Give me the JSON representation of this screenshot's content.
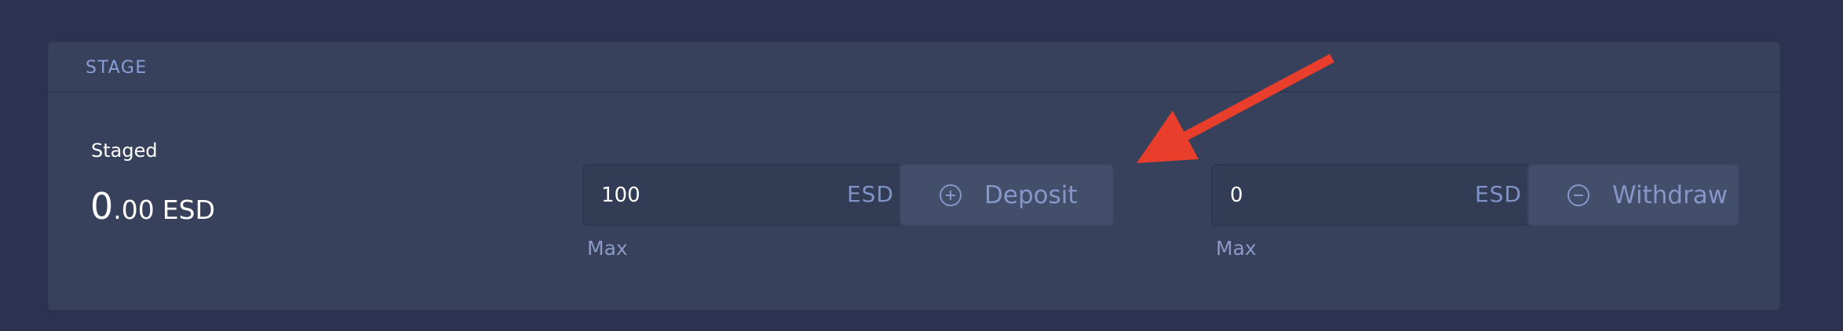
{
  "stage_panel": {
    "title": "STAGE",
    "staged_label": "Staged",
    "staged_value_int": "0",
    "staged_value_dec": ".00",
    "staged_unit": "ESD"
  },
  "deposit": {
    "amount_value": "100",
    "unit": "ESD",
    "button_label": "Deposit",
    "button_icon": "plus-circle-icon",
    "max_label": "Max"
  },
  "withdraw": {
    "amount_value": "0",
    "unit": "ESD",
    "button_label": "Withdraw",
    "button_icon": "minus-circle-icon",
    "max_label": "Max"
  },
  "annotation": {
    "arrow_color": "#e93e2c"
  },
  "colors": {
    "page_background": "#2c3350",
    "panel_background": "#37415b",
    "accent_text": "#8a9fd8"
  }
}
